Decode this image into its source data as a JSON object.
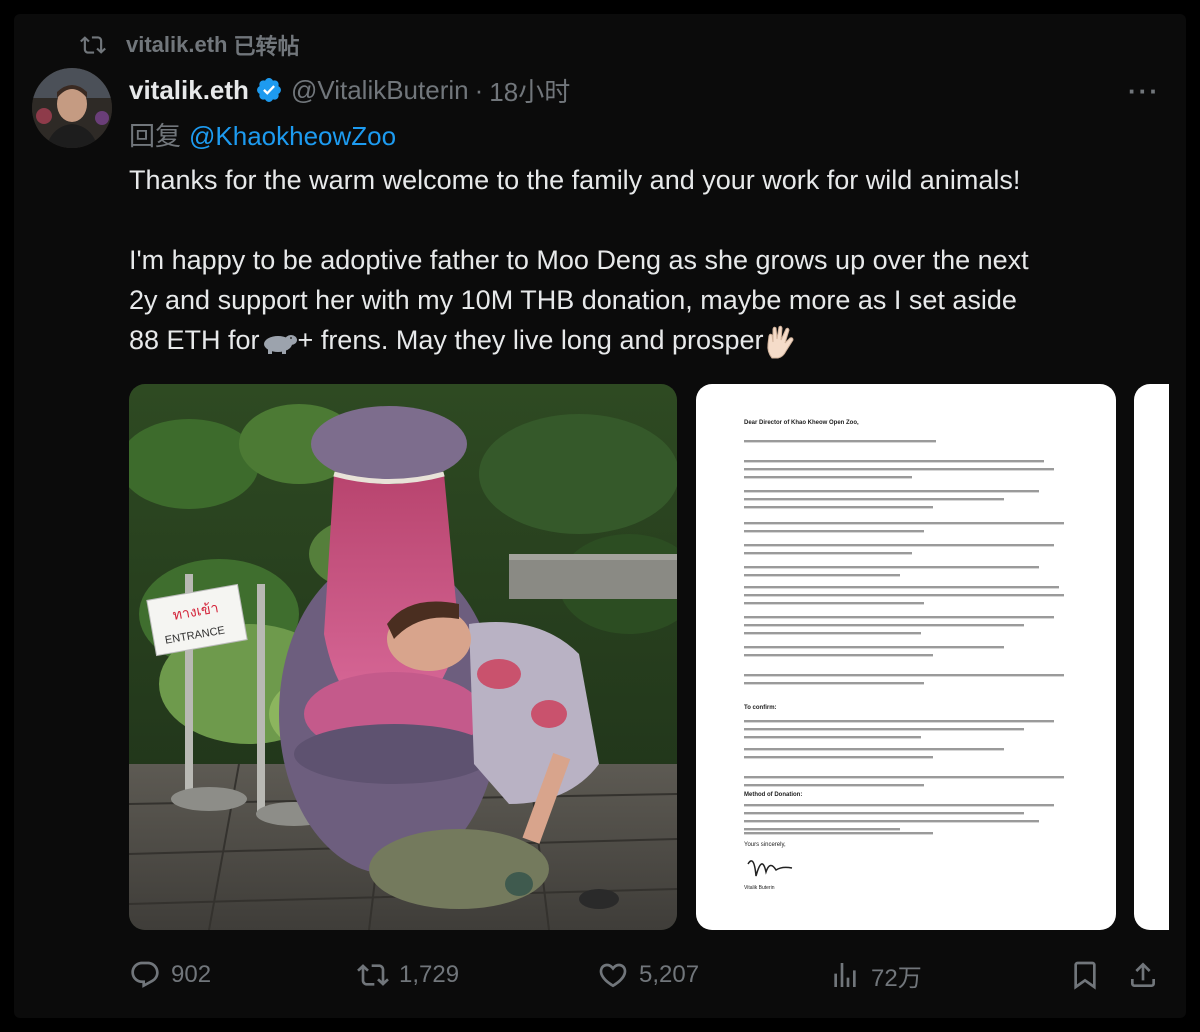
{
  "repost_context": {
    "user": "vitalik.eth",
    "label": "已转帖"
  },
  "tweet": {
    "display_name": "vitalik.eth",
    "handle": "@VitalikButerin",
    "separator": "·",
    "time": "18小时",
    "reply_label": "回复",
    "reply_to": "@KhaokheowZoo",
    "paragraph1": "Thanks for the warm welcome to the family and your work for wild animals!",
    "paragraph2_line1": "I'm happy to be adoptive father to Moo Deng as she grows up over the next",
    "paragraph2_line2": "2y and support her with my 10M THB donation, maybe more as I set aside",
    "paragraph2_line3_a": "88 ETH for",
    "paragraph2_line3_b": "+ frens. May they live long and prosper"
  },
  "photo": {
    "sign_thai": "ทางเข้า",
    "sign_english": "ENTRANCE"
  },
  "letter": {
    "greeting": "Dear Director of Khao Kheow Open Zoo,",
    "subheading_confirm": "To confirm:",
    "subheading_method": "Method of Donation:",
    "closing": "Yours sincerely,",
    "signer": "Vitalik Buterin"
  },
  "actions": {
    "replies": "902",
    "reposts": "1,729",
    "likes": "5,207",
    "views": "72万"
  },
  "icons": {
    "repost": "repost-icon",
    "verified": "verified-badge-icon",
    "more": "more-icon",
    "reply": "reply-icon",
    "like": "heart-icon",
    "views": "views-icon",
    "bookmark": "bookmark-icon",
    "share": "share-icon",
    "hippo": "hippo-emoji",
    "vulcan": "vulcan-salute-emoji"
  },
  "colors": {
    "background": "#000000",
    "text": "#e7e9ea",
    "muted": "#71767b",
    "link": "#1d9bf0",
    "verified": "#1d9bf0"
  }
}
